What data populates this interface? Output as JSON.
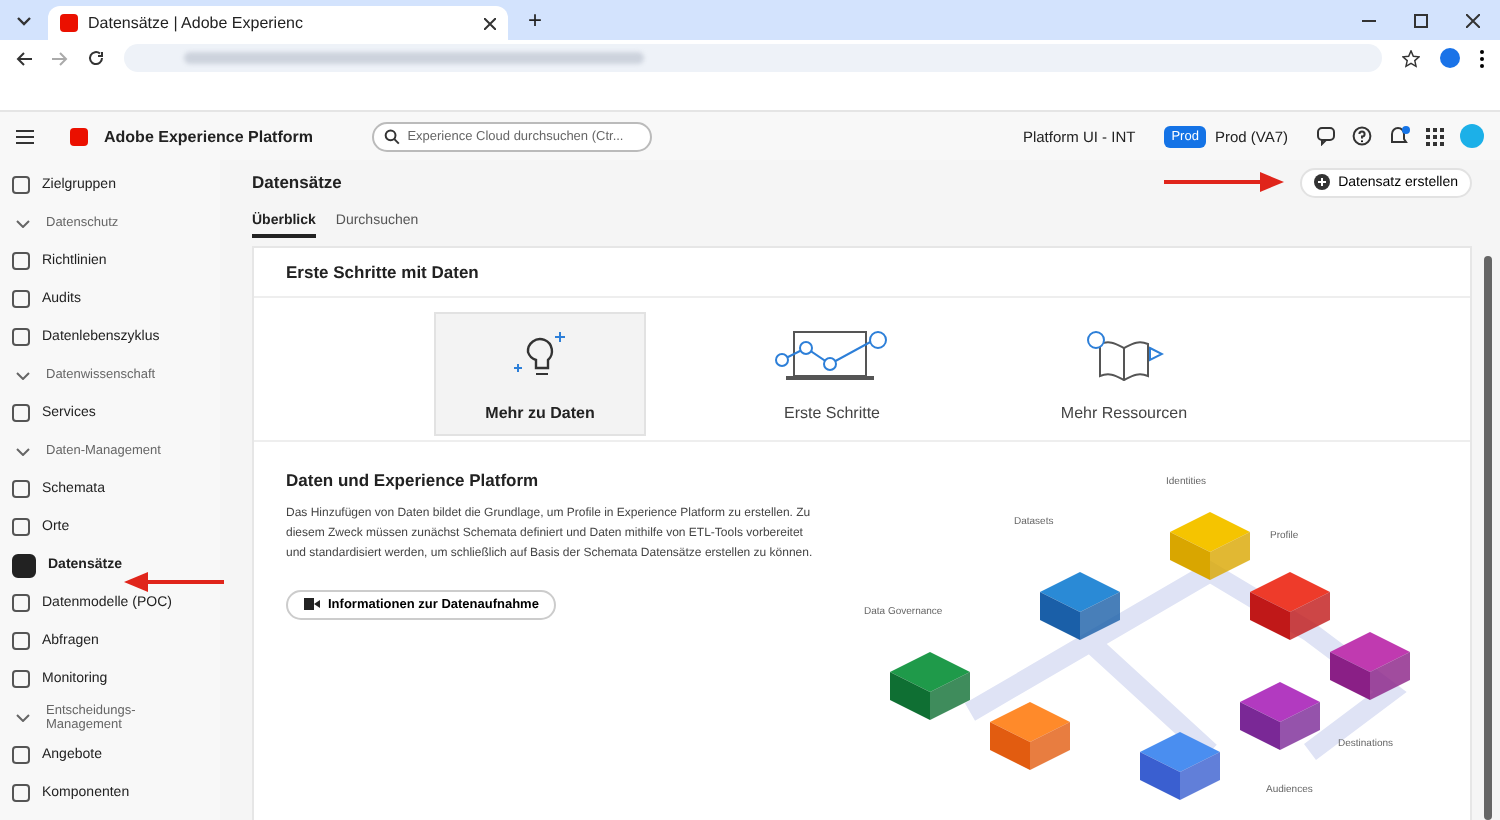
{
  "browser": {
    "tab_title": "Datensätze | Adobe Experienc",
    "new_tab": "+"
  },
  "header": {
    "product": "Adobe Experience Platform",
    "search_placeholder": "Experience Cloud durchsuchen (Ctr...",
    "org": "Platform UI - INT",
    "env_badge": "Prod",
    "env_name": "Prod (VA7)"
  },
  "sidebar": {
    "items": [
      {
        "kind": "item",
        "label": "Zielgruppen",
        "selected": false
      },
      {
        "kind": "section",
        "label": "Datenschutz",
        "expanded": true
      },
      {
        "kind": "item",
        "label": "Richtlinien",
        "selected": false
      },
      {
        "kind": "item",
        "label": "Audits",
        "selected": false
      },
      {
        "kind": "item",
        "label": "Datenlebenszyklus",
        "selected": false
      },
      {
        "kind": "section",
        "label": "Datenwissenschaft",
        "expanded": true
      },
      {
        "kind": "item",
        "label": "Services",
        "selected": false
      },
      {
        "kind": "section",
        "label": "Daten-Management",
        "expanded": true
      },
      {
        "kind": "item",
        "label": "Schemata",
        "selected": false
      },
      {
        "kind": "item",
        "label": "Orte",
        "selected": false
      },
      {
        "kind": "item",
        "label": "Datensätze",
        "selected": true
      },
      {
        "kind": "item",
        "label": "Datenmodelle (POC)",
        "selected": false
      },
      {
        "kind": "item",
        "label": "Abfragen",
        "selected": false
      },
      {
        "kind": "item",
        "label": "Monitoring",
        "selected": false
      },
      {
        "kind": "section",
        "label": "Entscheidungs-Management",
        "expanded": true
      },
      {
        "kind": "item",
        "label": "Angebote",
        "selected": false
      },
      {
        "kind": "item",
        "label": "Komponenten",
        "selected": false
      }
    ]
  },
  "page": {
    "title": "Datensätze",
    "create_button": "Datensatz erstellen",
    "tabs": [
      {
        "label": "Überblick",
        "selected": true
      },
      {
        "label": "Durchsuchen",
        "selected": false
      }
    ]
  },
  "card": {
    "title": "Erste Schritte mit Daten",
    "tiles": [
      {
        "label": "Mehr zu Daten",
        "kind": "bulb",
        "selected": true
      },
      {
        "label": "Erste Schritte",
        "kind": "laptop",
        "selected": false
      },
      {
        "label": "Mehr Ressourcen",
        "kind": "book",
        "selected": false
      }
    ],
    "section_title": "Daten und Experience Platform",
    "body": "Das Hinzufügen von Daten bildet die Grundlage, um Profile in Experience Platform zu erstellen. Zu diesem Zweck müssen zunächst Schemata definiert und Daten mithilfe von ETL-Tools vorbereitet und standardisiert werden, um schließlich auf Basis der Schemata Datensätze erstellen zu können.",
    "video_button": "Informationen zur Datenaufnahme",
    "diagram_labels": [
      "Identities",
      "Datasets",
      "Profile",
      "Data Governance",
      "Destinations",
      "Audiences"
    ]
  }
}
